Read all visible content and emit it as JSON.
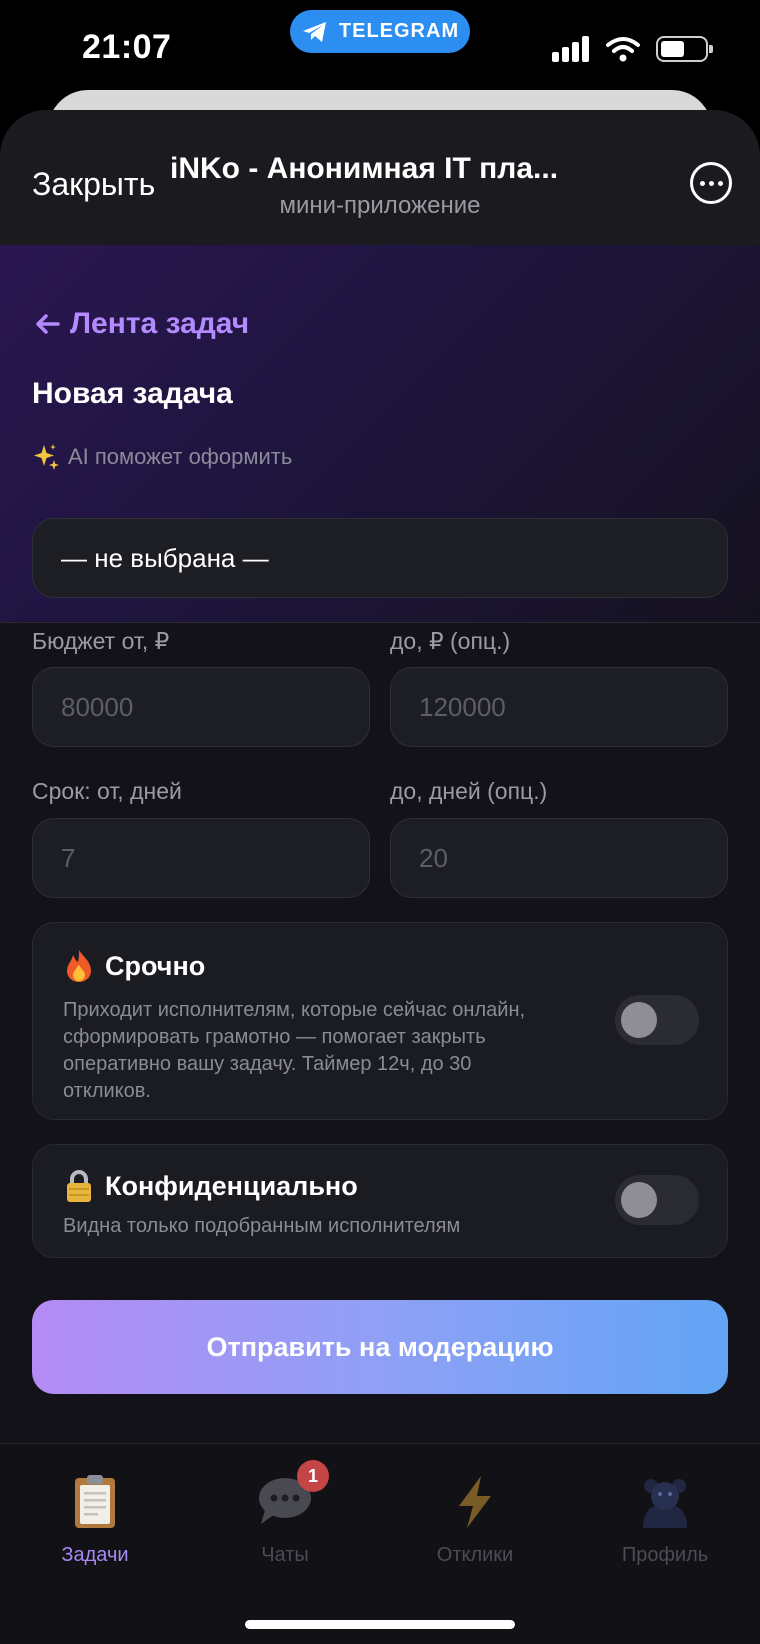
{
  "status": {
    "time": "21:07",
    "telegram_label": "TELEGRAM"
  },
  "header": {
    "close_label": "Закрыть",
    "title": "iNKo - Анонимная IT пла...",
    "subtitle": "мини-приложение"
  },
  "hero": {
    "back_label": "Лента задач",
    "page_title": "Новая задача",
    "ai_hint": "AI поможет оформить"
  },
  "form": {
    "category_value": "— не выбрана —",
    "budget_from_label": "Бюджет от, ₽",
    "budget_from_placeholder": "80000",
    "budget_to_label": "до, ₽ (опц.)",
    "budget_to_placeholder": "120000",
    "term_from_label": "Срок: от, дней",
    "term_from_placeholder": "7",
    "term_to_label": "до, дней (опц.)",
    "term_to_placeholder": "20"
  },
  "urgent": {
    "title": "Срочно",
    "desc_lines": [
      "Приходит исполнителям, которые сейчас онлайн,",
      "сформировать грамотно — помогает закрыть",
      "оперативно вашу задачу. Таймер 12ч, до 30",
      "откликов."
    ],
    "enabled": false
  },
  "confidential": {
    "title": "Конфиденциально",
    "desc": "Видна только подобранным исполнителям",
    "enabled": false
  },
  "submit_label": "Отправить на модерацию",
  "tabs": [
    {
      "label": "Задачи",
      "icon": "clipboard-icon",
      "active": true
    },
    {
      "label": "Чаты",
      "icon": "chat-bubble-icon",
      "badge": "1"
    },
    {
      "label": "Отклики",
      "icon": "lightning-icon"
    },
    {
      "label": "Профиль",
      "icon": "avatar-icon"
    }
  ],
  "colors": {
    "accent": "#b38bff",
    "telegram": "#2b8ef0",
    "badge": "#c44545"
  }
}
